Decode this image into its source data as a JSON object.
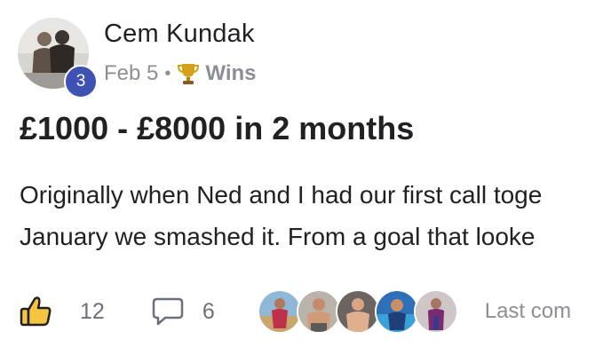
{
  "post": {
    "author": {
      "name": "Cem Kundak",
      "level": "3"
    },
    "date": "Feb 5",
    "separator": "•",
    "category_icon": "trophy-icon",
    "category": "Wins",
    "title": "£1000 - £8000 in 2 months",
    "body_lines": [
      "Originally when Ned and I had our first call toge",
      "January we smashed it. From a goal that looke"
    ],
    "likes": "12",
    "comments": "6",
    "commenter_avatar_count": 5,
    "last_comment": "Last com"
  },
  "colors": {
    "badge": "#3f51b5",
    "muted_text": "#8a8f98",
    "trophy": "#d4a017",
    "like_icon_outline": "#1f1f1f",
    "like_icon_fill": "#f5c542"
  }
}
